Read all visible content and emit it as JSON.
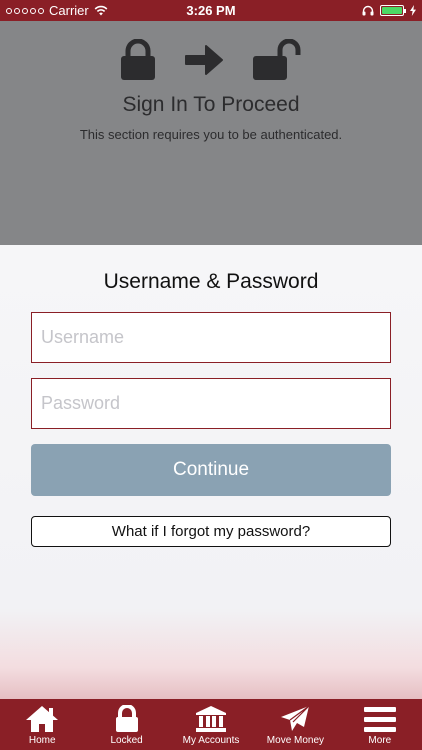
{
  "status_bar": {
    "carrier": "Carrier",
    "time": "3:26 PM"
  },
  "locked_section": {
    "title": "Sign In To Proceed",
    "subtitle": "This section requires you to be authenticated."
  },
  "login": {
    "title": "Username & Password",
    "username_placeholder": "Username",
    "password_placeholder": "Password",
    "continue_label": "Continue",
    "forgot_label": "What if I forgot my password?"
  },
  "tab_bar": {
    "items": [
      {
        "label": "Home",
        "icon": "home-icon"
      },
      {
        "label": "Locked",
        "icon": "lock-icon"
      },
      {
        "label": "My Accounts",
        "icon": "bank-icon"
      },
      {
        "label": "Move Money",
        "icon": "paper-plane-icon"
      },
      {
        "label": "More",
        "icon": "menu-icon"
      }
    ]
  },
  "colors": {
    "brand": "#8a1f26",
    "continue_button": "#8aa2b3",
    "locked_overlay": "#858688"
  }
}
